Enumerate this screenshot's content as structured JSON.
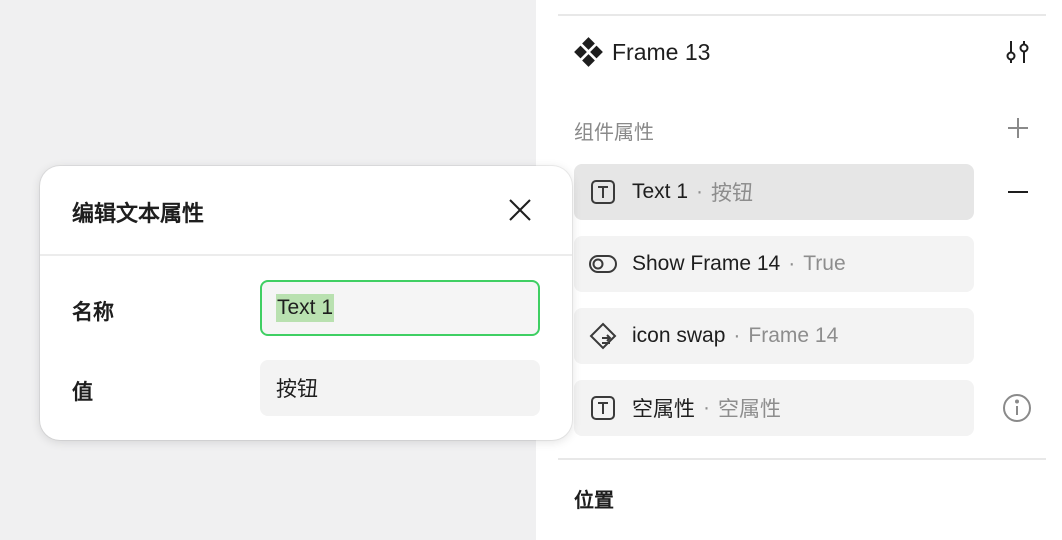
{
  "panel": {
    "frame_title": "Frame 13",
    "section_label": "组件属性",
    "properties": [
      {
        "name": "Text 1",
        "sep": "·",
        "value": "按钮",
        "icon": "text-icon"
      },
      {
        "name": "Show Frame 14",
        "sep": "·",
        "value": "True",
        "icon": "toggle-icon"
      },
      {
        "name": "icon swap",
        "sep": "·",
        "value": "Frame 14",
        "icon": "instance-swap-icon"
      },
      {
        "name": "空属性",
        "sep": "·",
        "value": "空属性",
        "icon": "text-icon"
      }
    ],
    "position_label": "位置"
  },
  "dialog": {
    "title": "编辑文本属性",
    "name_label": "名称",
    "name_value": "Text 1",
    "value_label": "值",
    "value_value": "按钮"
  },
  "colors": {
    "focus_border": "#3fcf63",
    "selection": "#b9e1b0",
    "row_bg": "#f3f3f3",
    "row_active_bg": "#e6e6e6"
  }
}
